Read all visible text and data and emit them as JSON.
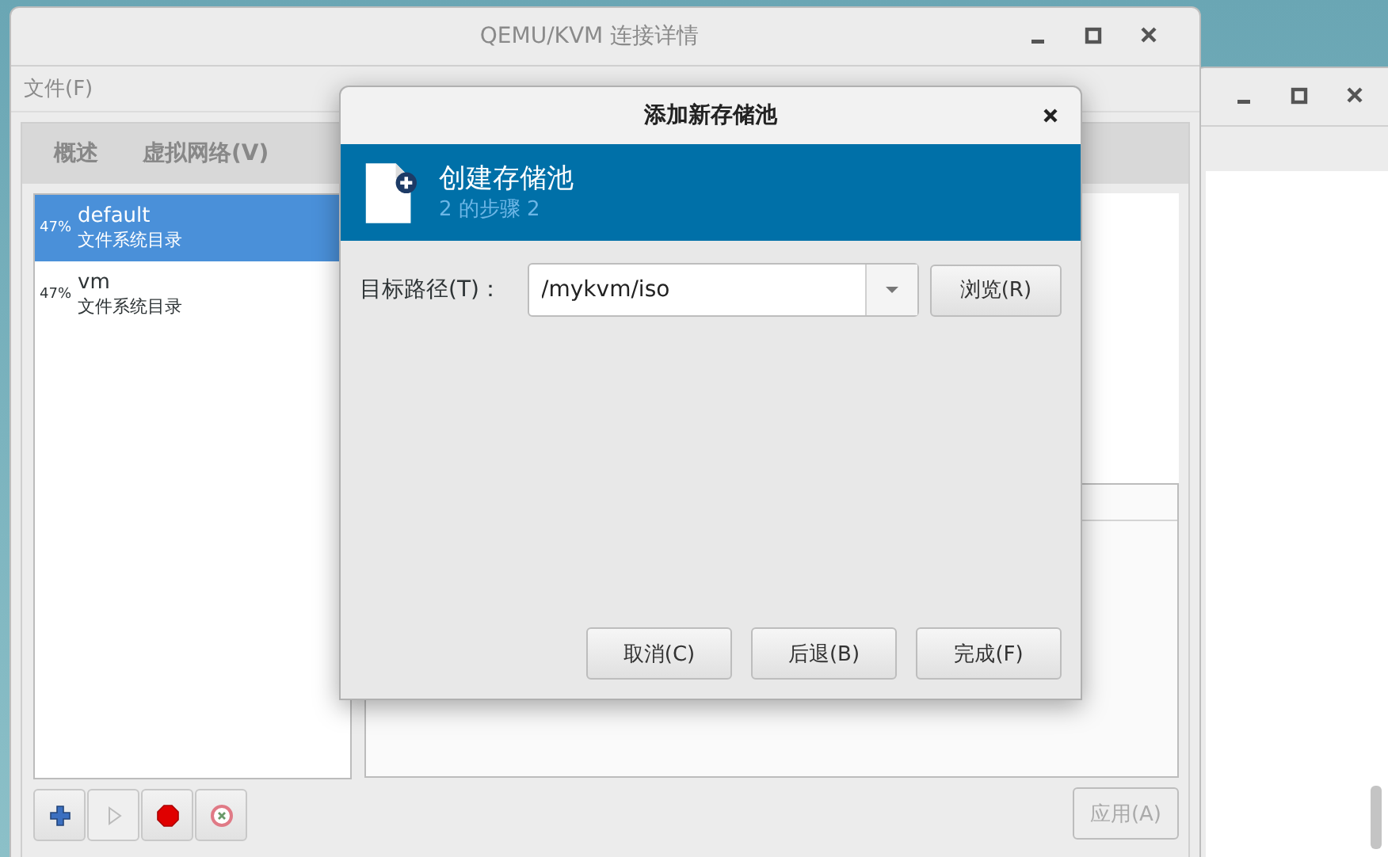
{
  "main_window": {
    "title": "QEMU/KVM 连接详情",
    "menu": [
      {
        "label": "文件(F)"
      }
    ],
    "tabs": [
      {
        "label": "概述",
        "selected": false
      },
      {
        "label": "虚拟网络(V)",
        "selected": false
      }
    ],
    "pools": [
      {
        "usage": "47%",
        "name": "default",
        "type": "文件系统目录",
        "selected": true
      },
      {
        "usage": "47%",
        "name": "vm",
        "type": "文件系统目录",
        "selected": false
      }
    ],
    "pool_buttons": [
      {
        "kind": "add",
        "disabled": false
      },
      {
        "kind": "start",
        "disabled": true
      },
      {
        "kind": "stop",
        "disabled": false
      },
      {
        "kind": "delete",
        "disabled": false
      }
    ],
    "apply_button": {
      "label": "应用(A)",
      "disabled": true
    }
  },
  "dialog": {
    "title": "添加新存储池",
    "header": {
      "title": "创建存储池",
      "step": "2 的步骤 2"
    },
    "target_path": {
      "label": "目标路径(T)：",
      "value": "/mykvm/iso"
    },
    "browse_button": "浏览(R)",
    "buttons": [
      {
        "label": "取消(C)"
      },
      {
        "label": "后退(B)"
      },
      {
        "label": "完成(F)"
      }
    ]
  }
}
